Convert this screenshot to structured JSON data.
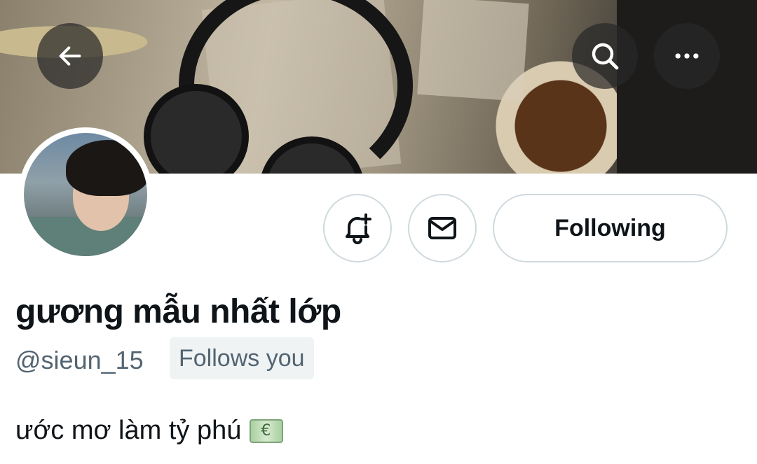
{
  "header": {
    "back_icon": "arrow-left-icon",
    "search_icon": "search-icon",
    "more_icon": "more-horizontal-icon"
  },
  "profile": {
    "display_name": "gương mẫu nhất lớp",
    "handle": "@sieun_15",
    "follows_you_label": "Follows you",
    "bio": "ước mơ làm tỷ phú"
  },
  "actions": {
    "notify_icon": "bell-plus-icon",
    "message_icon": "mail-icon",
    "following_label": "Following"
  },
  "colors": {
    "border": "#cfd9de",
    "secondary_text": "#536471",
    "badge_bg": "#eff3f4"
  }
}
